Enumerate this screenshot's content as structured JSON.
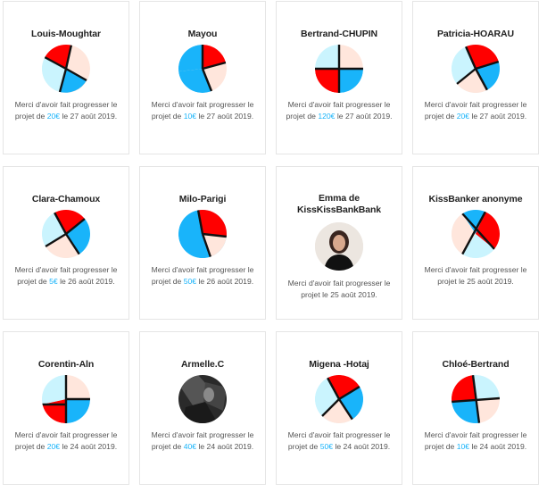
{
  "colors": {
    "accent": "#19b4fa",
    "pie_red": "#ff0000",
    "pie_blue": "#19b4fa",
    "pie_pink": "#ffe6dc",
    "pie_light": "#caf4fe",
    "text": "#222222",
    "muted": "#555555",
    "border": "#e5e5e5"
  },
  "msg": {
    "prefix": "Merci d'avoir fait progresser le projet",
    "de": "de",
    "le": "le"
  },
  "backers": [
    {
      "name": "Louis-Moughtar",
      "avatar": "pie-avatar-icon",
      "amount": "20€",
      "date": "27 août 2019."
    },
    {
      "name": "Mayou",
      "avatar": "pie-avatar-icon",
      "amount": "10€",
      "date": "27 août 2019."
    },
    {
      "name": "Bertrand-CHUPIN",
      "avatar": "pie-avatar-icon",
      "amount": "120€",
      "date": "27 août 2019."
    },
    {
      "name": "Patricia-HOARAU",
      "avatar": "pie-avatar-icon",
      "amount": "20€",
      "date": "27 août 2019."
    },
    {
      "name": "Clara-Chamoux",
      "avatar": "pie-avatar-icon",
      "amount": "5€",
      "date": "26 août 2019."
    },
    {
      "name": "Milo-Parigi",
      "avatar": "pie-avatar-icon",
      "amount": "50€",
      "date": "26 août 2019."
    },
    {
      "name": "Emma de KissKissBankBank",
      "avatar": "photo-avatar",
      "amount": "",
      "date": "25 août 2019."
    },
    {
      "name": "KissBanker anonyme",
      "avatar": "pie-avatar-icon",
      "amount": "",
      "date": "25 août 2019."
    },
    {
      "name": "Corentin-Aln",
      "avatar": "pie-avatar-icon",
      "amount": "20€",
      "date": "24 août 2019."
    },
    {
      "name": "Armelle.C",
      "avatar": "photo-avatar",
      "amount": "40€",
      "date": "24 août 2019."
    },
    {
      "name": "Migena -Hotaj",
      "avatar": "pie-avatar-icon",
      "amount": "50€",
      "date": "24 août 2019."
    },
    {
      "name": "Chloé-Bertrand",
      "avatar": "pie-avatar-icon",
      "amount": "10€",
      "date": "24 août 2019."
    }
  ]
}
